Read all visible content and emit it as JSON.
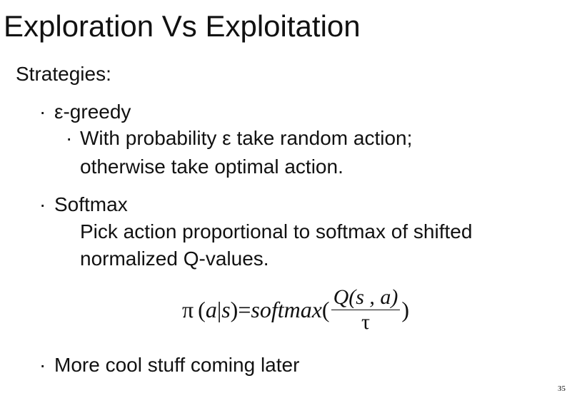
{
  "slide": {
    "title": "Exploration Vs Exploitation",
    "heading": "Strategies:",
    "bullet_glyph": "·",
    "items": [
      {
        "label": "ε-greedy",
        "sub": {
          "line1": "With probability ε take random action;",
          "line2": "otherwise take optimal action."
        }
      },
      {
        "label": "Softmax",
        "sub": {
          "line1": "Pick action proportional to softmax of shifted",
          "line2": "normalized Q-values."
        }
      },
      {
        "label": "More cool stuff coming later"
      }
    ],
    "formula": {
      "lhs_pi": "π",
      "lhs_open": "(",
      "lhs_a": "a",
      "lhs_bar": "|",
      "lhs_s": "s",
      "lhs_close": ")",
      "eq": "=",
      "func": "softmax",
      "open": "(",
      "numerator": "Q(s , a)",
      "denominator": "τ",
      "close": ")"
    },
    "page_number": "35"
  }
}
